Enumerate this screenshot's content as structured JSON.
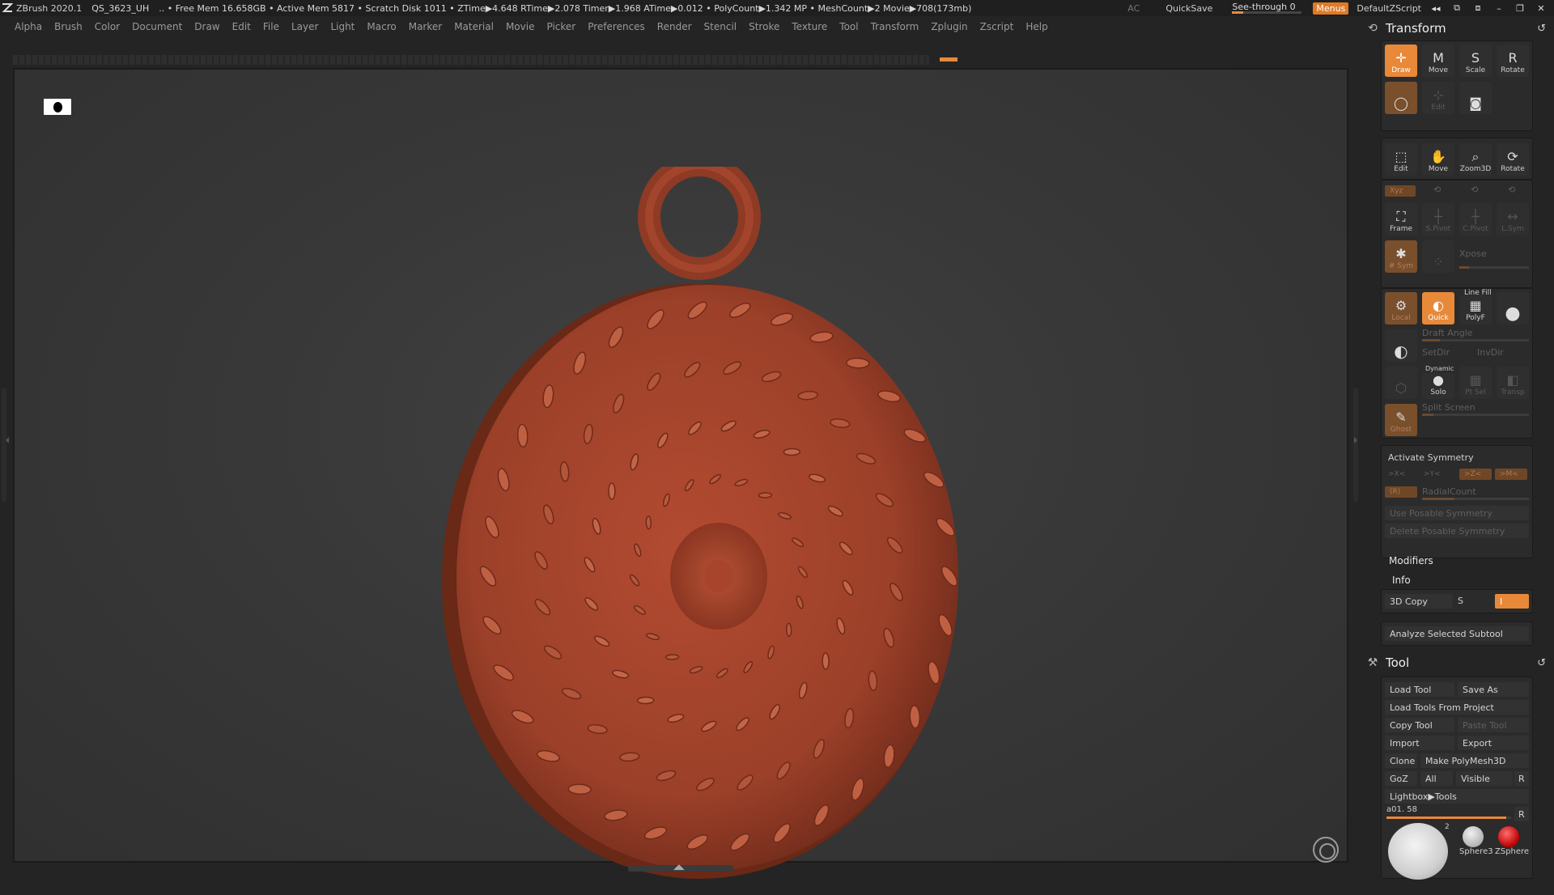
{
  "titlebar": {
    "app": "ZBrush 2020.1",
    "file": "QS_3623_UH",
    "stats": ".. • Free Mem 16.658GB • Active Mem 5817 • Scratch Disk 1011 •  ZTime▶4.648 RTime▶2.078 Timer▶1.968 ATime▶0.012 • PolyCount▶1.342 MP  • MeshCount▶2  Movie▶708(173mb)",
    "ac": "AC",
    "quicksave": "QuickSave",
    "seethrough": "See-through  0",
    "seethrough_value": 0,
    "menus": "Menus",
    "script": "DefaultZScript"
  },
  "menubar": [
    "Alpha",
    "Brush",
    "Color",
    "Document",
    "Draw",
    "Edit",
    "File",
    "Layer",
    "Light",
    "Macro",
    "Marker",
    "Material",
    "Movie",
    "Picker",
    "Preferences",
    "Render",
    "Stencil",
    "Stroke",
    "Texture",
    "Tool",
    "Transform",
    "Zplugin",
    "Zscript",
    "Help"
  ],
  "transform": {
    "title": "Transform",
    "row1": [
      "Draw",
      "Move",
      "Scale",
      "Rotate"
    ],
    "row2_labels": [
      "Edit"
    ],
    "row3": [
      "Edit",
      "Move",
      "Zoom3D",
      "Rotate"
    ],
    "xyz": "Xyz",
    "row5": [
      "Frame",
      "S.Pivot",
      "C.Pivot",
      "L.Sym"
    ],
    "row6": [
      "# Sym",
      "Xpose"
    ],
    "xpose_label": "Xpose",
    "local": "Local",
    "quick": "Quick",
    "linefill": "Line Fill",
    "polyf": "PolyF",
    "draft_angle": "Draft Angle",
    "setdir": "SetDir",
    "invdir": "InvDir",
    "dynamic": "Dynamic",
    "solo": "Solo",
    "ptsel": "Pt Sel",
    "transp": "Transp",
    "ghost": "Ghost",
    "split_screen": "Split Screen",
    "activate_symmetry": "Activate Symmetry",
    "sym_x": ">X<",
    "sym_y": ">Y<",
    "sym_z": ">Z<",
    "sym_m": ">M<",
    "sym_r": "(R)",
    "radial_count": "RadialCount",
    "use_posable": "Use Posable Symmetry",
    "delete_posable": "Delete Posable Symmetry"
  },
  "modifiers": "Modifiers",
  "info": "Info",
  "copy3d": {
    "label": "3D Copy",
    "s": "S",
    "i": "I"
  },
  "analyze": "Analyze Selected Subtool",
  "tool": {
    "title": "Tool",
    "load_tool": "Load Tool",
    "save_as": "Save As",
    "load_from_project": "Load Tools From Project",
    "copy_tool": "Copy Tool",
    "paste_tool": "Paste Tool",
    "import": "Import",
    "export": "Export",
    "clone": "Clone",
    "make_polymesh": "Make PolyMesh3D",
    "goz": "GoZ",
    "all": "All",
    "visible": "Visible",
    "r": "R",
    "lightbox_tools": "Lightbox▶Tools",
    "current_tool": "a01. 58",
    "r2": "R",
    "thumb_count": "2",
    "sphere3": "Sphere3",
    "zsphere": "ZSphere"
  },
  "colors": {
    "accent": "#e8893a",
    "mesh": "#a4452e",
    "panel": "#2b2b2b",
    "background": "#242424"
  }
}
